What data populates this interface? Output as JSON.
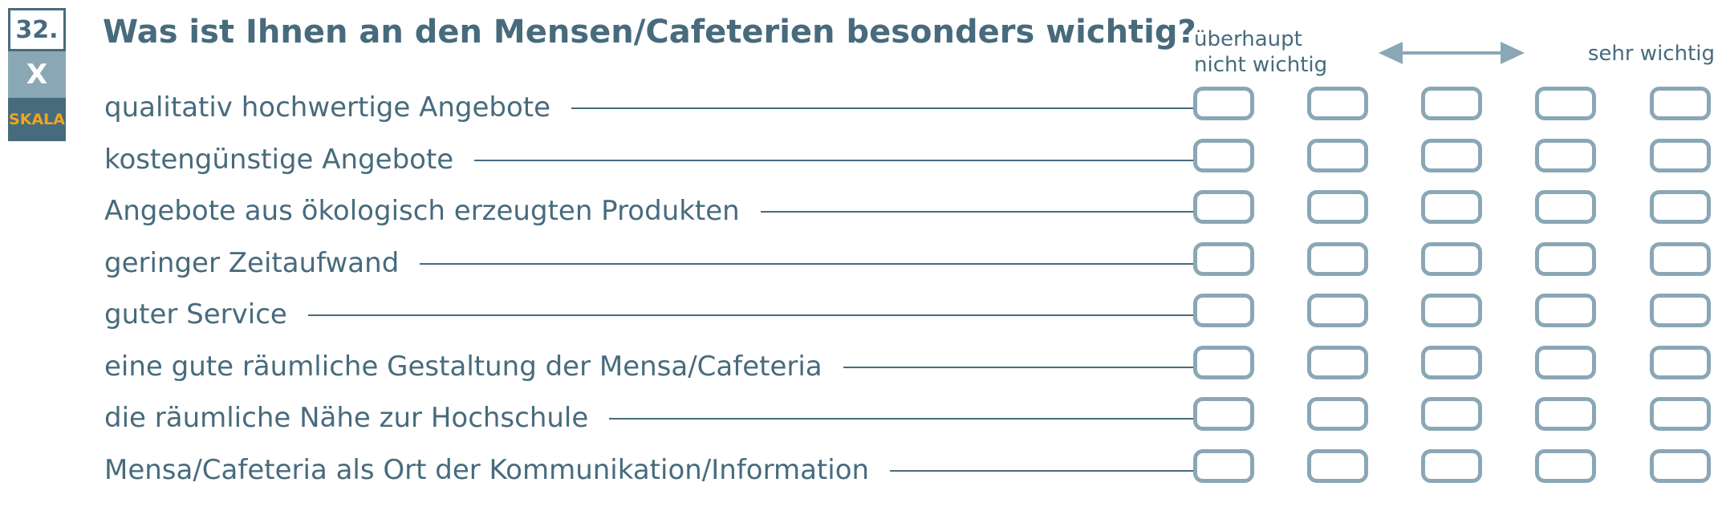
{
  "question": {
    "number": "32.",
    "type_mark": "X",
    "type_label": "SKALA",
    "title": "Was ist Ihnen an den Mensen/Cafeterien besonders wichtig?"
  },
  "scale": {
    "low_line1": "überhaupt",
    "low_line2": "nicht wichtig",
    "high": "sehr wichtig",
    "points": 5
  },
  "items": [
    "qualitativ hochwertige Angebote",
    "kostengünstige Angebote",
    "Angebote aus ökologisch erzeugten Produkten",
    "geringer Zeitaufwand",
    "guter Service",
    "eine gute räumliche Gestaltung der Mensa/Cafeteria",
    "die räumliche Nähe zur Hochschule",
    "Mensa/Cafeteria als Ort der Kommunikation/Information"
  ],
  "colors": {
    "primary": "#476b7d",
    "box_border": "#8aa7b6",
    "accent": "#f0a51e"
  }
}
